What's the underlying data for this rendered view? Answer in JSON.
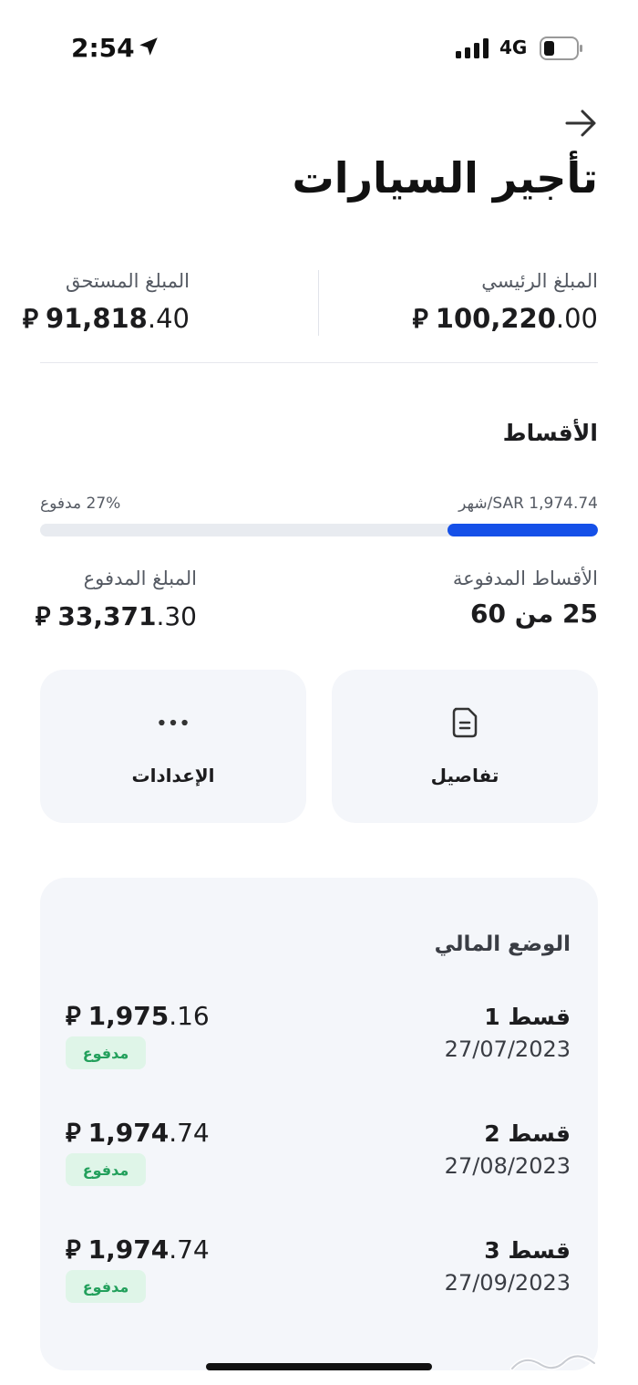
{
  "status_bar": {
    "time": "2:54",
    "network": "4G",
    "icons": [
      "location-arrow-icon",
      "signal-bars-icon",
      "battery-icon"
    ]
  },
  "header": {
    "back_icon": "arrow-right-icon",
    "title": "تأجير السيارات"
  },
  "summary": {
    "principal_label": "المبلغ الرئيسي",
    "principal_int": "100,220",
    "principal_dec": ".00",
    "due_label": "المبلغ المستحق",
    "due_int": "91,818",
    "due_dec": ".40",
    "currency_symbol": "⃁"
  },
  "installments": {
    "section_title": "الأقساط",
    "monthly_label": "SAR 1,974.74/شهر",
    "paid_percent_label": "27% مدفوع",
    "paid_fraction": 0.27,
    "progress_color": "#1550e8",
    "paid_count_label": "الأقساط المدفوعة",
    "paid_count_value": "25 من 60",
    "paid_amount_label": "المبلغ المدفوع",
    "paid_amount_int": "33,371",
    "paid_amount_dec": ".30"
  },
  "actions": {
    "details_label": "تفاصيل",
    "details_icon": "document-icon",
    "settings_label": "الإعدادات",
    "settings_icon": "more-dots-icon"
  },
  "financial_status": {
    "title": "الوضع المالي",
    "rows": [
      {
        "name": "قسط 1",
        "date": "27/07/2023",
        "amount_int": "1,975",
        "amount_dec": ".16",
        "status": "مدفوع"
      },
      {
        "name": "قسط 2",
        "date": "27/08/2023",
        "amount_int": "1,974",
        "amount_dec": ".74",
        "status": "مدفوع"
      },
      {
        "name": "قسط 3",
        "date": "27/09/2023",
        "amount_int": "1,974",
        "amount_dec": ".74",
        "status": "مدفوع"
      }
    ],
    "paid_badge_color": "#23a05c"
  }
}
